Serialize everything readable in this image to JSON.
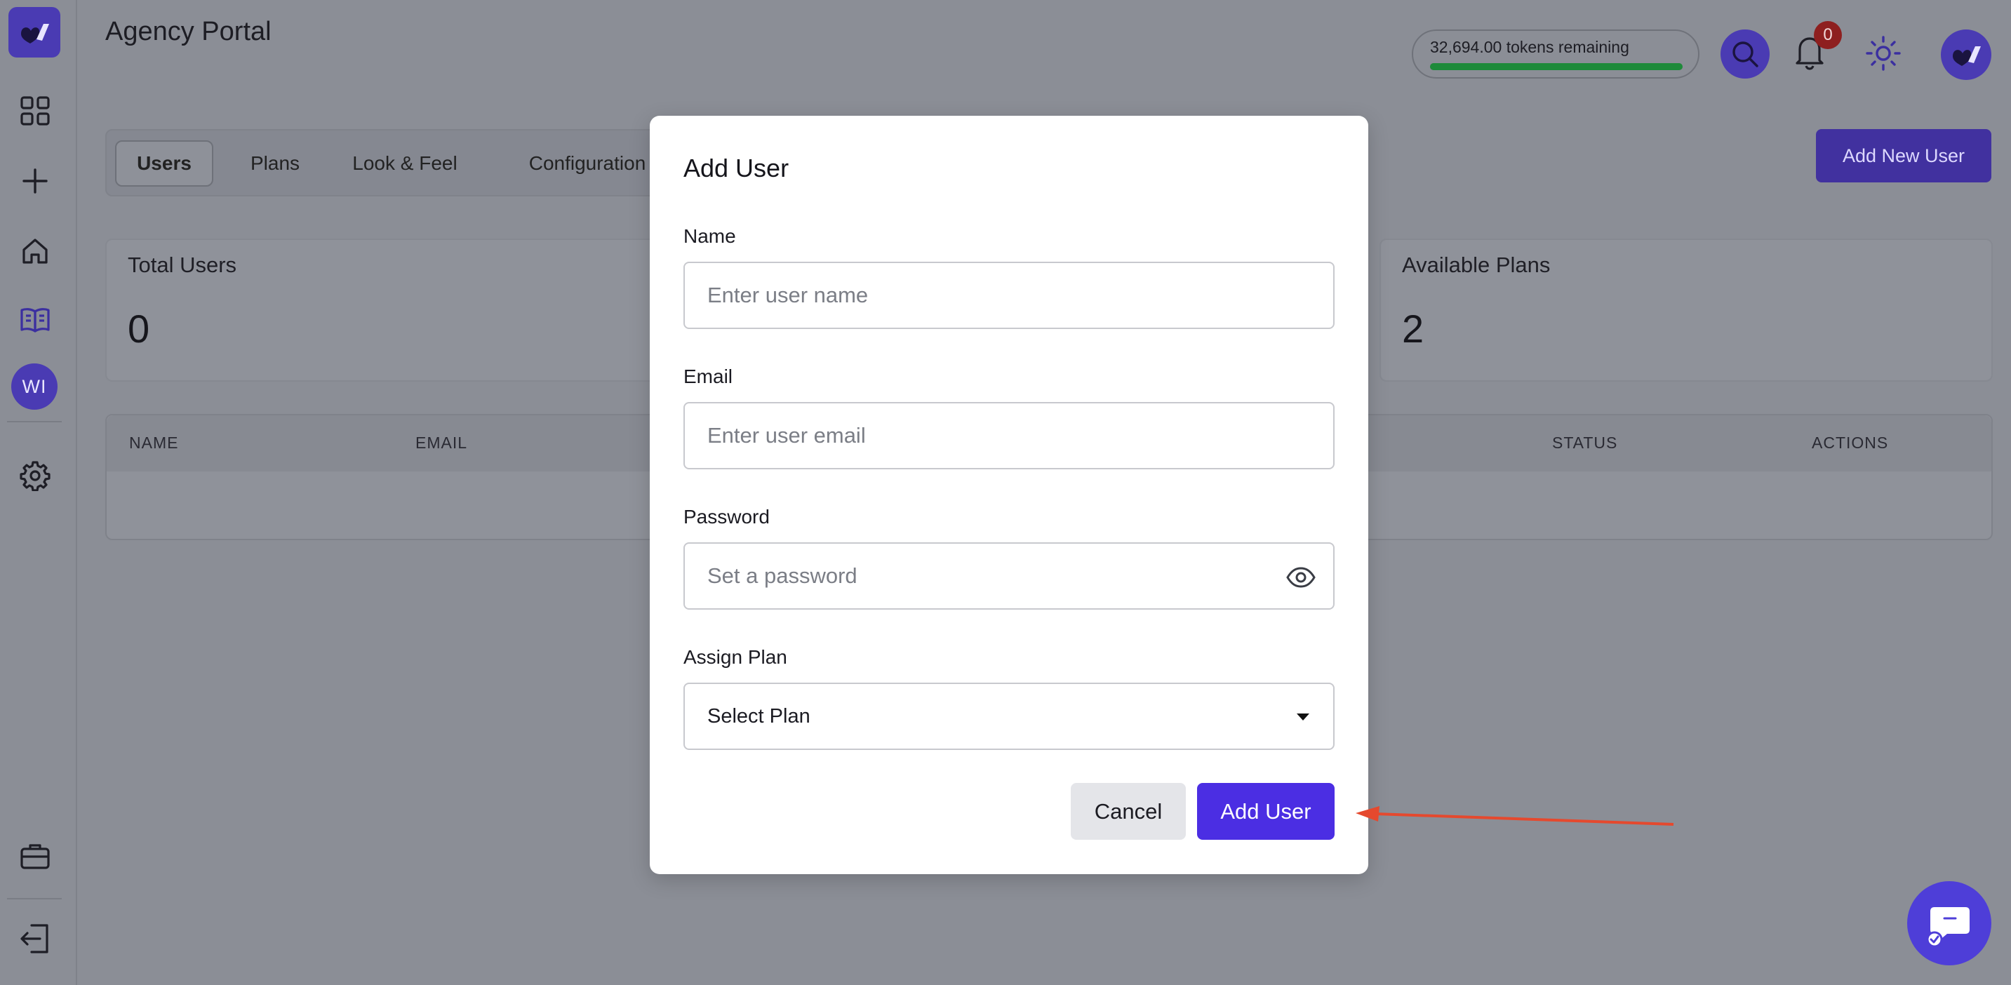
{
  "app": {
    "title": "Agency Portal"
  },
  "sidebar": {
    "avatar_initials": "WI",
    "items": [
      {
        "icon": "grid-icon"
      },
      {
        "icon": "plus-icon"
      },
      {
        "icon": "home-icon"
      },
      {
        "icon": "book-icon"
      },
      {
        "icon": "gear-icon"
      },
      {
        "icon": "briefcase-icon"
      },
      {
        "icon": "logout-icon"
      }
    ]
  },
  "header": {
    "tokens_text": "32,694.00 tokens remaining",
    "tokens_fraction": 1.0,
    "notification_count": "0"
  },
  "tabs": [
    {
      "label": "Users",
      "active": true
    },
    {
      "label": "Plans",
      "active": false
    },
    {
      "label": "Look & Feel",
      "active": false
    },
    {
      "label": "Configuration",
      "active": false
    }
  ],
  "actions": {
    "add_new_user_label": "Add New User"
  },
  "stats": {
    "total_users_label": "Total Users",
    "total_users_value": "0",
    "available_plans_label": "Available Plans",
    "available_plans_value": "2"
  },
  "table": {
    "columns": [
      "NAME",
      "EMAIL",
      "STATUS",
      "ACTIONS"
    ]
  },
  "modal": {
    "title": "Add User",
    "name_label": "Name",
    "name_placeholder": "Enter user name",
    "email_label": "Email",
    "email_placeholder": "Enter user email",
    "password_label": "Password",
    "password_placeholder": "Set a password",
    "plan_label": "Assign Plan",
    "plan_value": "Select Plan",
    "cancel_label": "Cancel",
    "submit_label": "Add User"
  },
  "colors": {
    "brand": "#4b2ee3",
    "overlay_bg": "#8b8e96",
    "badge": "#8e1f1f",
    "progress": "#1e8a3a",
    "annotation_arrow": "#e5492e"
  }
}
